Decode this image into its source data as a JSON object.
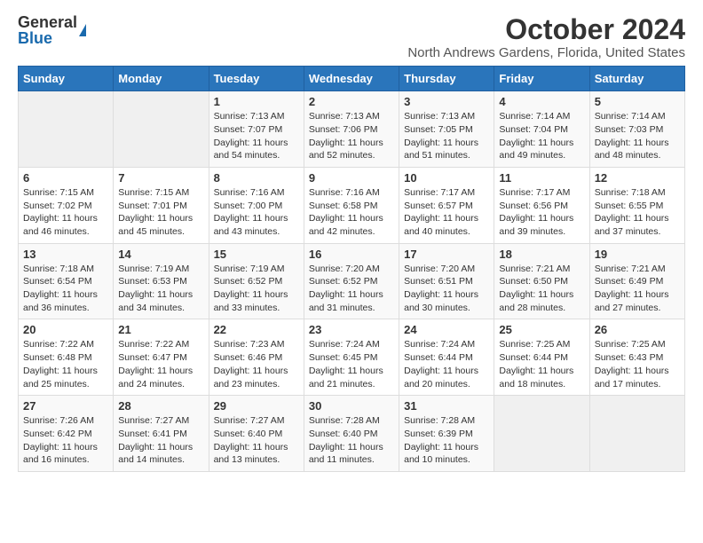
{
  "logo": {
    "general": "General",
    "blue": "Blue"
  },
  "title": "October 2024",
  "location": "North Andrews Gardens, Florida, United States",
  "weekdays": [
    "Sunday",
    "Monday",
    "Tuesday",
    "Wednesday",
    "Thursday",
    "Friday",
    "Saturday"
  ],
  "weeks": [
    [
      {
        "day": "",
        "sunrise": "",
        "sunset": "",
        "daylight": ""
      },
      {
        "day": "",
        "sunrise": "",
        "sunset": "",
        "daylight": ""
      },
      {
        "day": "1",
        "sunrise": "Sunrise: 7:13 AM",
        "sunset": "Sunset: 7:07 PM",
        "daylight": "Daylight: 11 hours and 54 minutes."
      },
      {
        "day": "2",
        "sunrise": "Sunrise: 7:13 AM",
        "sunset": "Sunset: 7:06 PM",
        "daylight": "Daylight: 11 hours and 52 minutes."
      },
      {
        "day": "3",
        "sunrise": "Sunrise: 7:13 AM",
        "sunset": "Sunset: 7:05 PM",
        "daylight": "Daylight: 11 hours and 51 minutes."
      },
      {
        "day": "4",
        "sunrise": "Sunrise: 7:14 AM",
        "sunset": "Sunset: 7:04 PM",
        "daylight": "Daylight: 11 hours and 49 minutes."
      },
      {
        "day": "5",
        "sunrise": "Sunrise: 7:14 AM",
        "sunset": "Sunset: 7:03 PM",
        "daylight": "Daylight: 11 hours and 48 minutes."
      }
    ],
    [
      {
        "day": "6",
        "sunrise": "Sunrise: 7:15 AM",
        "sunset": "Sunset: 7:02 PM",
        "daylight": "Daylight: 11 hours and 46 minutes."
      },
      {
        "day": "7",
        "sunrise": "Sunrise: 7:15 AM",
        "sunset": "Sunset: 7:01 PM",
        "daylight": "Daylight: 11 hours and 45 minutes."
      },
      {
        "day": "8",
        "sunrise": "Sunrise: 7:16 AM",
        "sunset": "Sunset: 7:00 PM",
        "daylight": "Daylight: 11 hours and 43 minutes."
      },
      {
        "day": "9",
        "sunrise": "Sunrise: 7:16 AM",
        "sunset": "Sunset: 6:58 PM",
        "daylight": "Daylight: 11 hours and 42 minutes."
      },
      {
        "day": "10",
        "sunrise": "Sunrise: 7:17 AM",
        "sunset": "Sunset: 6:57 PM",
        "daylight": "Daylight: 11 hours and 40 minutes."
      },
      {
        "day": "11",
        "sunrise": "Sunrise: 7:17 AM",
        "sunset": "Sunset: 6:56 PM",
        "daylight": "Daylight: 11 hours and 39 minutes."
      },
      {
        "day": "12",
        "sunrise": "Sunrise: 7:18 AM",
        "sunset": "Sunset: 6:55 PM",
        "daylight": "Daylight: 11 hours and 37 minutes."
      }
    ],
    [
      {
        "day": "13",
        "sunrise": "Sunrise: 7:18 AM",
        "sunset": "Sunset: 6:54 PM",
        "daylight": "Daylight: 11 hours and 36 minutes."
      },
      {
        "day": "14",
        "sunrise": "Sunrise: 7:19 AM",
        "sunset": "Sunset: 6:53 PM",
        "daylight": "Daylight: 11 hours and 34 minutes."
      },
      {
        "day": "15",
        "sunrise": "Sunrise: 7:19 AM",
        "sunset": "Sunset: 6:52 PM",
        "daylight": "Daylight: 11 hours and 33 minutes."
      },
      {
        "day": "16",
        "sunrise": "Sunrise: 7:20 AM",
        "sunset": "Sunset: 6:52 PM",
        "daylight": "Daylight: 11 hours and 31 minutes."
      },
      {
        "day": "17",
        "sunrise": "Sunrise: 7:20 AM",
        "sunset": "Sunset: 6:51 PM",
        "daylight": "Daylight: 11 hours and 30 minutes."
      },
      {
        "day": "18",
        "sunrise": "Sunrise: 7:21 AM",
        "sunset": "Sunset: 6:50 PM",
        "daylight": "Daylight: 11 hours and 28 minutes."
      },
      {
        "day": "19",
        "sunrise": "Sunrise: 7:21 AM",
        "sunset": "Sunset: 6:49 PM",
        "daylight": "Daylight: 11 hours and 27 minutes."
      }
    ],
    [
      {
        "day": "20",
        "sunrise": "Sunrise: 7:22 AM",
        "sunset": "Sunset: 6:48 PM",
        "daylight": "Daylight: 11 hours and 25 minutes."
      },
      {
        "day": "21",
        "sunrise": "Sunrise: 7:22 AM",
        "sunset": "Sunset: 6:47 PM",
        "daylight": "Daylight: 11 hours and 24 minutes."
      },
      {
        "day": "22",
        "sunrise": "Sunrise: 7:23 AM",
        "sunset": "Sunset: 6:46 PM",
        "daylight": "Daylight: 11 hours and 23 minutes."
      },
      {
        "day": "23",
        "sunrise": "Sunrise: 7:24 AM",
        "sunset": "Sunset: 6:45 PM",
        "daylight": "Daylight: 11 hours and 21 minutes."
      },
      {
        "day": "24",
        "sunrise": "Sunrise: 7:24 AM",
        "sunset": "Sunset: 6:44 PM",
        "daylight": "Daylight: 11 hours and 20 minutes."
      },
      {
        "day": "25",
        "sunrise": "Sunrise: 7:25 AM",
        "sunset": "Sunset: 6:44 PM",
        "daylight": "Daylight: 11 hours and 18 minutes."
      },
      {
        "day": "26",
        "sunrise": "Sunrise: 7:25 AM",
        "sunset": "Sunset: 6:43 PM",
        "daylight": "Daylight: 11 hours and 17 minutes."
      }
    ],
    [
      {
        "day": "27",
        "sunrise": "Sunrise: 7:26 AM",
        "sunset": "Sunset: 6:42 PM",
        "daylight": "Daylight: 11 hours and 16 minutes."
      },
      {
        "day": "28",
        "sunrise": "Sunrise: 7:27 AM",
        "sunset": "Sunset: 6:41 PM",
        "daylight": "Daylight: 11 hours and 14 minutes."
      },
      {
        "day": "29",
        "sunrise": "Sunrise: 7:27 AM",
        "sunset": "Sunset: 6:40 PM",
        "daylight": "Daylight: 11 hours and 13 minutes."
      },
      {
        "day": "30",
        "sunrise": "Sunrise: 7:28 AM",
        "sunset": "Sunset: 6:40 PM",
        "daylight": "Daylight: 11 hours and 11 minutes."
      },
      {
        "day": "31",
        "sunrise": "Sunrise: 7:28 AM",
        "sunset": "Sunset: 6:39 PM",
        "daylight": "Daylight: 11 hours and 10 minutes."
      },
      {
        "day": "",
        "sunrise": "",
        "sunset": "",
        "daylight": ""
      },
      {
        "day": "",
        "sunrise": "",
        "sunset": "",
        "daylight": ""
      }
    ]
  ]
}
